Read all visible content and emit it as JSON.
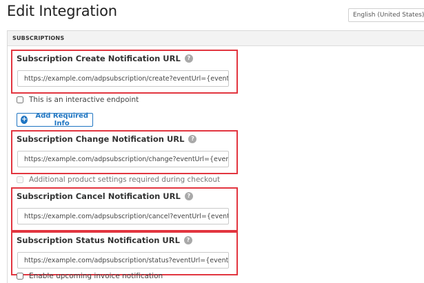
{
  "page": {
    "title": "Edit Integration"
  },
  "language_select": {
    "value": "English (United States)"
  },
  "section": {
    "header": "SUBSCRIPTIONS"
  },
  "fields": {
    "create": {
      "label": "Subscription Create Notification URL",
      "value": "https://example.com/adpsubscription/create?eventUrl={eventUrl}"
    },
    "change": {
      "label": "Subscription Change Notification URL",
      "value": "https://example.com/adpsubscription/change?eventUrl={eventUrl}"
    },
    "cancel": {
      "label": "Subscription Cancel Notification URL",
      "value": "https://example.com/adpsubscription/cancel?eventUrl={eventUrl}"
    },
    "status": {
      "label": "Subscription Status Notification URL",
      "value": "https://example.com/adpsubscription/status?eventUrl={eventUrl}"
    }
  },
  "checkboxes": {
    "interactive_endpoint": "This is an interactive endpoint",
    "additional_settings": "Additional product settings required during checkout",
    "upcoming_invoice": "Enable upcoming invoice notification"
  },
  "buttons": {
    "add_required_info": "Add Required Info"
  },
  "icons": {
    "help": "?",
    "plus": "+"
  },
  "colors": {
    "highlight_border": "#e2353f",
    "link_blue": "#1f75c2"
  }
}
